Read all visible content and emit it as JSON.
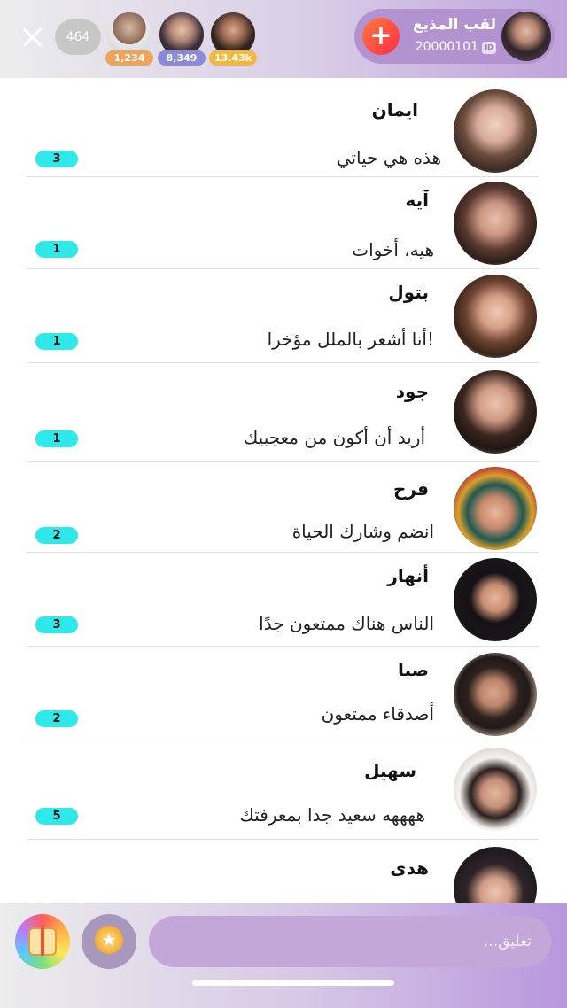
{
  "header": {
    "viewer_count": "464",
    "top_viewers": [
      {
        "count": "1,234",
        "badge_color": "#f0a35c"
      },
      {
        "count": "8,349",
        "badge_color": "#8b8ad8"
      },
      {
        "count": "13.43k",
        "badge_color": "#f4b840"
      }
    ],
    "host": {
      "name": "لقب المذيع",
      "id": "20000101",
      "id_label": "ID",
      "follow_icon": "+"
    }
  },
  "rows": [
    {
      "name": "ايمان",
      "message": "هذه هي حياتي",
      "badge": "3"
    },
    {
      "name": "آيه",
      "message": "هيه، أخوات",
      "badge": "1"
    },
    {
      "name": "بتول",
      "message": "!أنا أشعر بالملل مؤخرا",
      "badge": "1"
    },
    {
      "name": "جود",
      "message": "أريد أن أكون من معجبيك",
      "badge": "1"
    },
    {
      "name": "فرح",
      "message": "انضم وشارك الحياة",
      "badge": "2"
    },
    {
      "name": "أنهار",
      "message": "الناس هناك ممتعون جدًا",
      "badge": "3"
    },
    {
      "name": "صبا",
      "message": "أصدقاء ممتعون",
      "badge": "2"
    },
    {
      "name": "سهيل",
      "message": "ههههه سعيد جدا بمعرفتك",
      "badge": "5"
    },
    {
      "name": "هدى",
      "message": "",
      "badge": ""
    }
  ],
  "footer": {
    "comment_placeholder": "تعليق..."
  },
  "colors": {
    "badge": "#2ee8ea",
    "follow": "#ff3b4a"
  },
  "icons": [
    "close-icon",
    "plus-icon",
    "id-icon",
    "gift-icon",
    "star-coin-icon"
  ]
}
